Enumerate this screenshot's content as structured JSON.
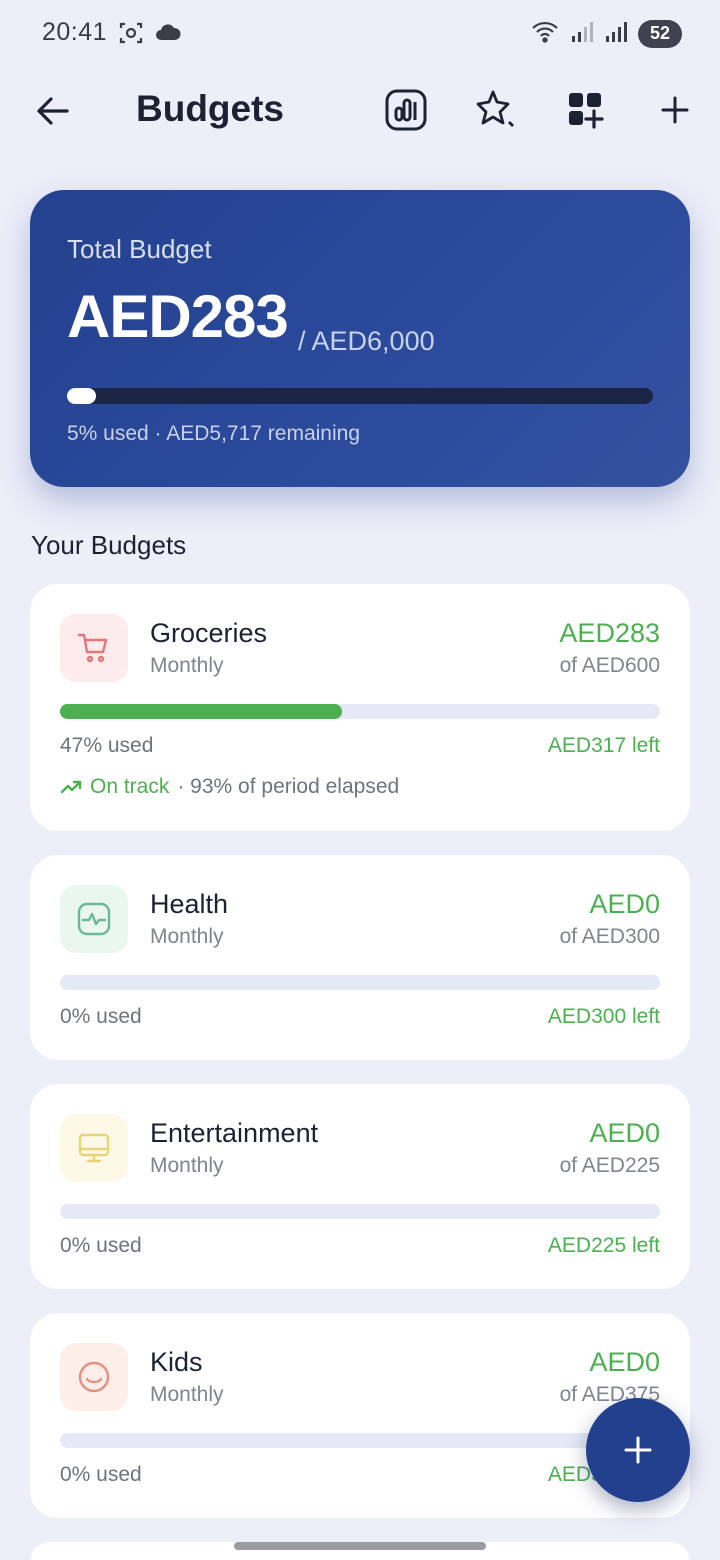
{
  "status_bar": {
    "time": "20:41",
    "battery": "52",
    "icons": [
      "screenshot-icon",
      "cloud-icon",
      "wifi-icon",
      "signal-icon",
      "signal-r-icon"
    ]
  },
  "header": {
    "title": "Budgets",
    "actions": [
      "chart-icon",
      "sparkle-icon",
      "grid-add-icon",
      "plus-icon"
    ]
  },
  "summary": {
    "label": "Total Budget",
    "spent": "AED283",
    "total": "/ AED6,000",
    "used_fraction": 0.05,
    "note": "5% used · AED5,717 remaining"
  },
  "section_title": "Your Budgets",
  "budgets": [
    {
      "name": "Groceries",
      "period": "Monthly",
      "spent": "AED283",
      "limit": "of AED600",
      "used_fraction": 0.47,
      "used_text": "47% used",
      "left_text": "AED317 left",
      "status_label": "On track",
      "status_note": "· 93% of period elapsed",
      "icon": "cart-icon",
      "icon_color": "#e0787a",
      "icon_bg": "#fdeceb"
    },
    {
      "name": "Health",
      "period": "Monthly",
      "spent": "AED0",
      "limit": "of AED300",
      "used_fraction": 0,
      "used_text": "0% used",
      "left_text": "AED300 left",
      "icon": "health-icon",
      "icon_color": "#6ab89a",
      "icon_bg": "#eaf6f0"
    },
    {
      "name": "Entertainment",
      "period": "Monthly",
      "spent": "AED0",
      "limit": "of AED225",
      "used_fraction": 0,
      "used_text": "0% used",
      "left_text": "AED225 left",
      "icon": "monitor-icon",
      "icon_color": "#e9d27a",
      "icon_bg": "#fdf9e6"
    },
    {
      "name": "Kids",
      "period": "Monthly",
      "spent": "AED0",
      "limit": "of AED375",
      "used_fraction": 0,
      "used_text": "0% used",
      "left_text": "AED375 left",
      "icon": "smile-icon",
      "icon_color": "#e6907f",
      "icon_bg": "#fdeeea"
    }
  ],
  "colors": {
    "accent": "#24418f",
    "positive": "#4caf50",
    "background": "#eceef8"
  }
}
